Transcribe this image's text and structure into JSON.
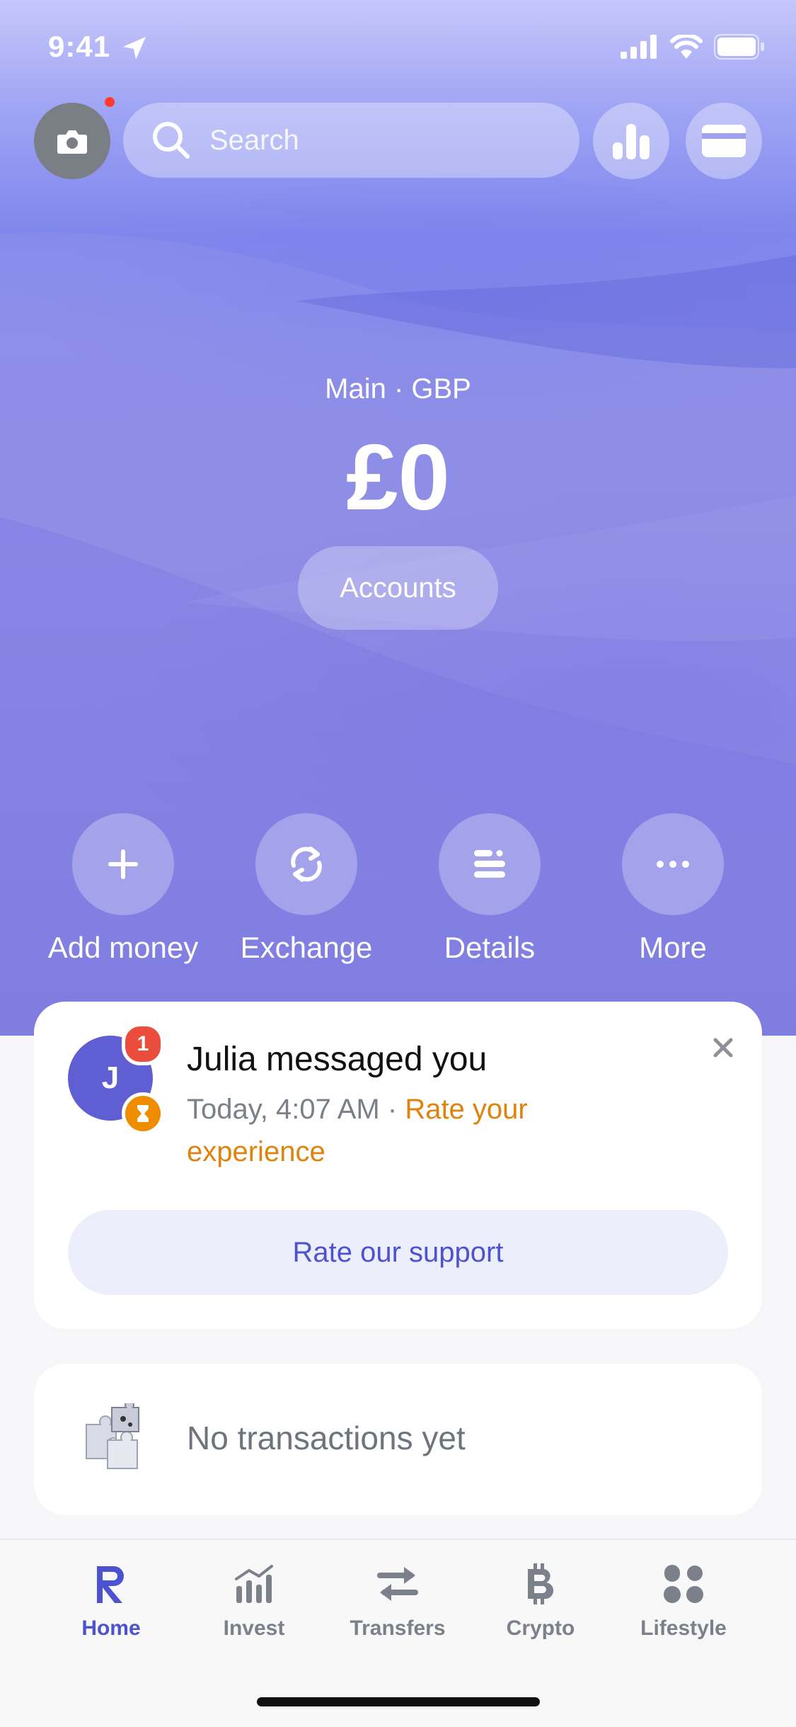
{
  "status": {
    "time": "9:41"
  },
  "topbar": {
    "search_placeholder": "Search"
  },
  "balance": {
    "account_label": "Main · GBP",
    "amount": "£0",
    "accounts_button": "Accounts"
  },
  "actions": [
    {
      "label": "Add money",
      "icon": "plus-icon"
    },
    {
      "label": "Exchange",
      "icon": "exchange-icon"
    },
    {
      "label": "Details",
      "icon": "details-icon"
    },
    {
      "label": "More",
      "icon": "more-dots-icon"
    }
  ],
  "message_card": {
    "avatar_initial": "J",
    "badge_count": "1",
    "title": "Julia messaged you",
    "timestamp": "Today, 4:07 AM · ",
    "link": "Rate your experience",
    "button": "Rate our support"
  },
  "transactions": {
    "empty_text": "No transactions yet"
  },
  "tabs": [
    {
      "label": "Home",
      "icon": "revolut-r-icon",
      "active": true
    },
    {
      "label": "Invest",
      "icon": "invest-chart-icon",
      "active": false
    },
    {
      "label": "Transfers",
      "icon": "transfers-arrows-icon",
      "active": false
    },
    {
      "label": "Crypto",
      "icon": "bitcoin-icon",
      "active": false
    },
    {
      "label": "Lifestyle",
      "icon": "lifestyle-grid-icon",
      "active": false
    }
  ],
  "colors": {
    "accent": "#4d52d1",
    "link_orange": "#e0820e",
    "badge_red": "#eb4d3d",
    "avatar": "#5f5fd3"
  }
}
